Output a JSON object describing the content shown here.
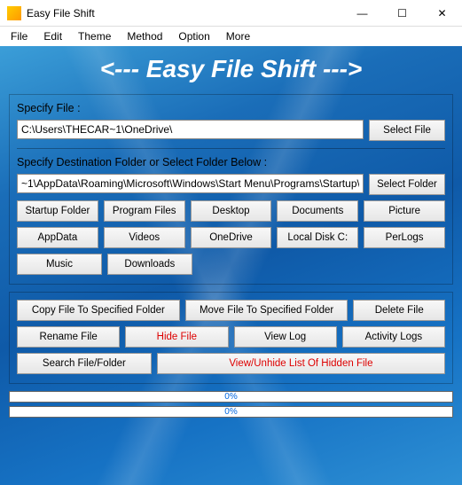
{
  "window": {
    "title": "Easy File Shift"
  },
  "menu": [
    "File",
    "Edit",
    "Theme",
    "Method",
    "Option",
    "More"
  ],
  "banner": "<---  Easy File Shift  --->",
  "filePanel": {
    "label": "Specify File :",
    "path": "C:\\Users\\THECAR~1\\OneDrive\\",
    "selectBtn": "Select File"
  },
  "destPanel": {
    "label": "Specify Destination Folder or Select Folder Below :",
    "path": "~1\\AppData\\Roaming\\Microsoft\\Windows\\Start Menu\\Programs\\Startup\\",
    "selectBtn": "Select Folder",
    "quick1": [
      "Startup Folder",
      "Program Files",
      "Desktop",
      "Documents",
      "Picture"
    ],
    "quick2": [
      "AppData",
      "Videos",
      "OneDrive",
      "Local Disk C:",
      "PerLogs"
    ],
    "quick3": [
      "Music",
      "Downloads"
    ]
  },
  "actions": {
    "row1": [
      "Copy File To Specified Folder",
      "Move File To Specified Folder",
      "Delete File"
    ],
    "row2": [
      "Rename File",
      "Hide File",
      "View Log",
      "Activity Logs"
    ],
    "row3": [
      "Search File/Folder",
      "View/Unhide List Of Hidden File"
    ]
  },
  "progress": {
    "p1": "0%",
    "p2": "0%"
  }
}
